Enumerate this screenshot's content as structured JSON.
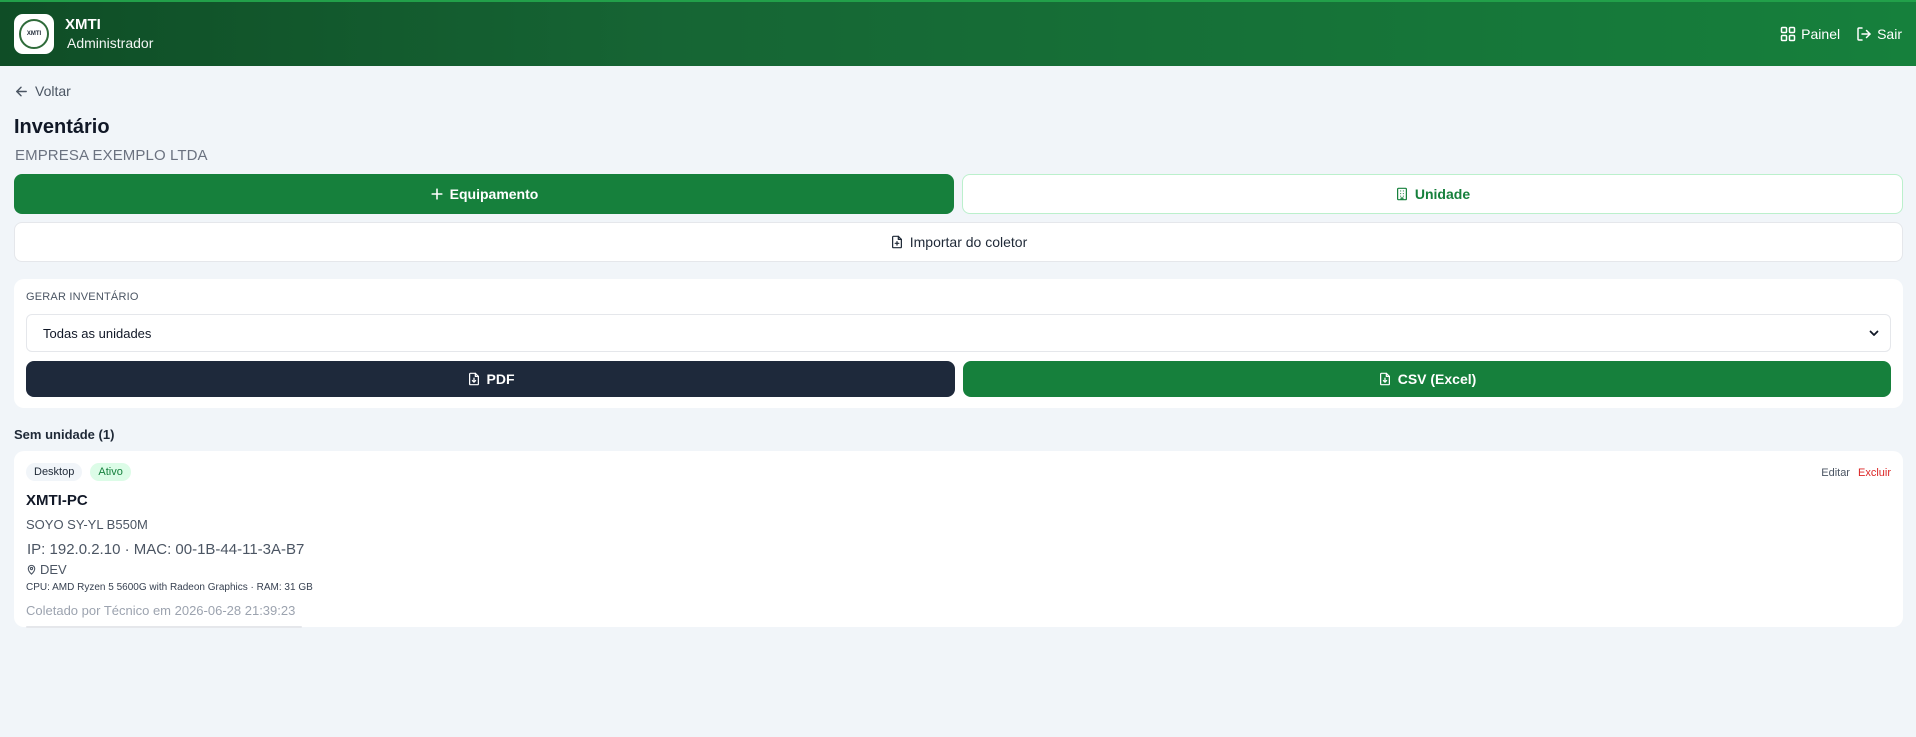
{
  "app": {
    "name": "XMTI",
    "role": "Administrador",
    "logo_text": "XMTI"
  },
  "nav": {
    "panel_label": "Painel",
    "logout_label": "Sair"
  },
  "page": {
    "back_label": "Voltar",
    "title": "Inventário",
    "company": "EMPRESA EXEMPLO LTDA"
  },
  "actions": {
    "add_equipment": "Equipamento",
    "add_unit": "Unidade",
    "import": "Importar do coletor"
  },
  "report": {
    "label": "GERAR INVENTÁRIO",
    "selected_unit": "Todas as unidades",
    "pdf_label": "PDF",
    "csv_label": "CSV (Excel)"
  },
  "group": {
    "title": "Sem unidade (1)"
  },
  "equipment": {
    "type": "Desktop",
    "status": "Ativo",
    "hostname": "XMTI-PC",
    "model": "SOYO SY-YL B550M",
    "network": "IP: 192.0.2.10 · MAC: 00-1B-44-11-3A-B7",
    "location": "DEV",
    "specs": "CPU: AMD Ryzen 5 5600G with Radeon Graphics · RAM: 31 GB",
    "collected": "Coletado por Técnico em 2026-06-28 21:39:23",
    "edit_label": "Editar",
    "delete_label": "Excluir"
  },
  "colors": {
    "brand_green": "#16803c",
    "header_dark": "#0f4d26",
    "pdf_button": "#1e293b",
    "delete_red": "#dc2626"
  }
}
